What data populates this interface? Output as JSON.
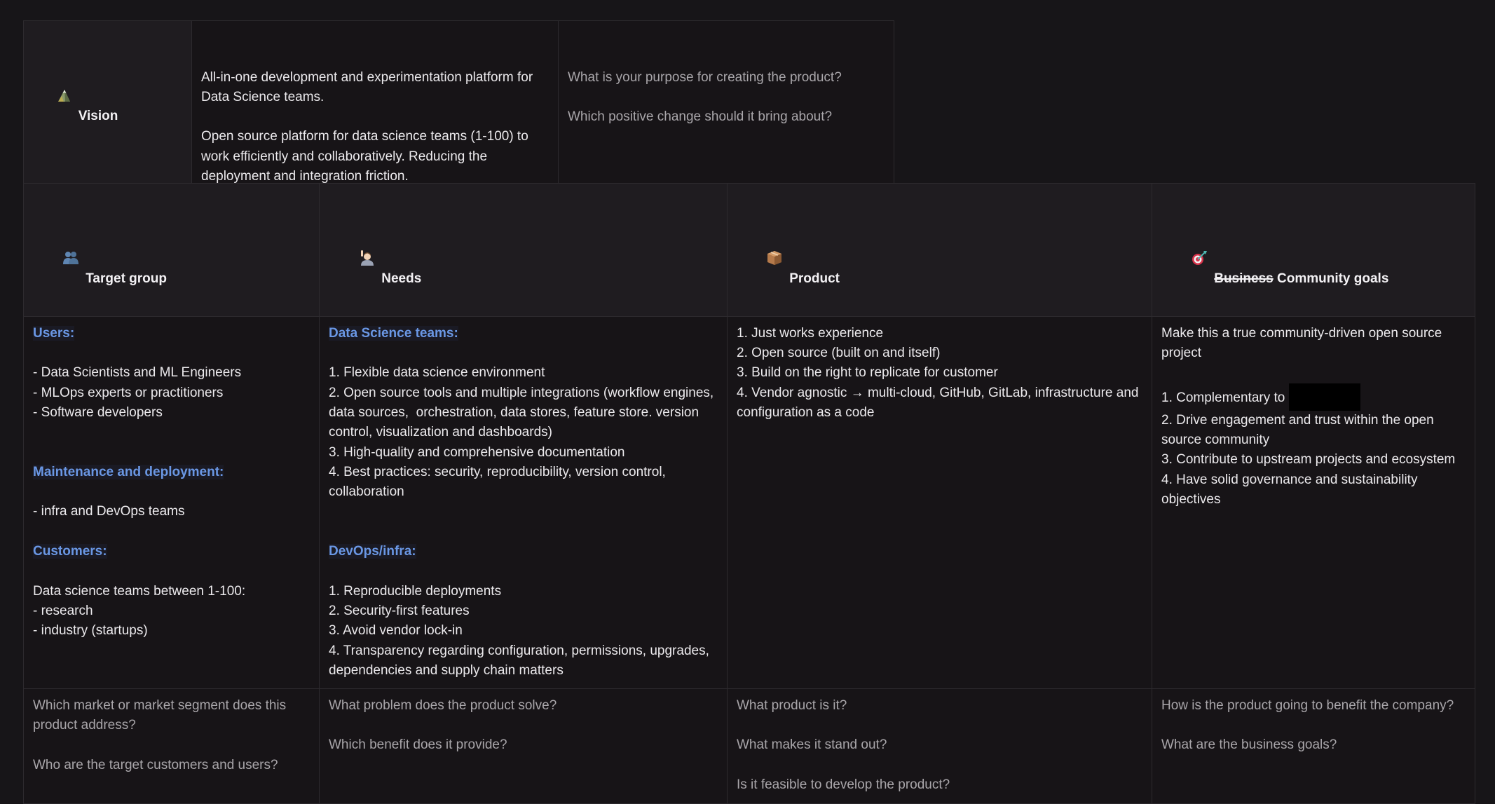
{
  "vision": {
    "icon": "mountain-icon",
    "title": "Vision",
    "statement_lines": [
      "All-in-one development and experimentation platform for Data Science teams.",
      "",
      "Open source platform for data science teams (1-100) to work efficiently and collaboratively. Reducing the deployment and integration friction."
    ],
    "guidance_lines": [
      "What is your purpose for creating the product?",
      "",
      "Which positive change should it bring about?"
    ]
  },
  "board": {
    "columns": [
      {
        "icon": "people-icon",
        "title": "Target group",
        "title_struck": "",
        "content": [
          {
            "type": "label",
            "text": "Users:"
          },
          {
            "type": "blank",
            "text": ""
          },
          {
            "type": "text",
            "text": "- Data Scientists and ML Engineers"
          },
          {
            "type": "text",
            "text": "- MLOps experts or practitioners"
          },
          {
            "type": "text",
            "text": "- Software developers"
          },
          {
            "type": "blank",
            "text": ""
          },
          {
            "type": "blank",
            "text": ""
          },
          {
            "type": "label",
            "text": "Maintenance and deployment:"
          },
          {
            "type": "blank",
            "text": ""
          },
          {
            "type": "text",
            "text": "- infra and DevOps teams"
          },
          {
            "type": "blank",
            "text": ""
          },
          {
            "type": "label",
            "text": "Customers:"
          },
          {
            "type": "blank",
            "text": ""
          },
          {
            "type": "text",
            "text": "Data science teams between 1-100:"
          },
          {
            "type": "text",
            "text": "- research"
          },
          {
            "type": "text",
            "text": "- industry (startups)"
          }
        ],
        "questions": [
          "Which market or market segment does this product address?",
          "",
          "Who are the target customers and users?"
        ]
      },
      {
        "icon": "raising-hand-icon",
        "title": "Needs",
        "title_struck": "",
        "content": [
          {
            "type": "label",
            "text": "Data Science teams:"
          },
          {
            "type": "blank",
            "text": ""
          },
          {
            "type": "text",
            "text": "1. Flexible data science environment"
          },
          {
            "type": "text",
            "text": "2. Open source tools and multiple integrations (workflow engines, data sources,  orchestration, data stores, feature store. version control, visualization and dashboards)"
          },
          {
            "type": "text",
            "text": "3. High-quality and comprehensive documentation"
          },
          {
            "type": "text",
            "text": "4. Best practices: security, reproducibility, version control, collaboration"
          },
          {
            "type": "blank",
            "text": ""
          },
          {
            "type": "blank",
            "text": ""
          },
          {
            "type": "label",
            "text": "DevOps/infra:"
          },
          {
            "type": "blank",
            "text": ""
          },
          {
            "type": "text",
            "text": "1. Reproducible deployments"
          },
          {
            "type": "text",
            "text": "2. Security-first features"
          },
          {
            "type": "text",
            "text": "3. Avoid vendor lock-in"
          },
          {
            "type": "text",
            "text": "4. Transparency regarding configuration, permissions, upgrades, dependencies and supply chain matters"
          }
        ],
        "questions": [
          "What problem does the product solve?",
          "",
          "Which benefit does it provide?"
        ]
      },
      {
        "icon": "package-icon",
        "title": "Product",
        "title_struck": "",
        "content": [
          {
            "type": "text",
            "text": "1. Just works experience"
          },
          {
            "type": "text",
            "text": "2. Open source (built on and itself)"
          },
          {
            "type": "text",
            "text": "3. Build on the right to replicate for customer"
          },
          {
            "type": "text",
            "text": "4. Vendor agnostic → multi-cloud, GitHub, GitLab, infrastructure and configuration as a code"
          }
        ],
        "questions": [
          "What product is it?",
          "",
          "What makes it stand out?",
          "",
          "Is it feasible to develop the product?"
        ]
      },
      {
        "icon": "target-icon",
        "title": "Community goals",
        "title_struck": "Business",
        "content": [
          {
            "type": "text",
            "text": "Make this a true community-driven open source project"
          },
          {
            "type": "blank",
            "text": ""
          },
          {
            "type": "redacted",
            "text": "1. Complementary to "
          },
          {
            "type": "text",
            "text": "2. Drive engagement and trust within the open source community"
          },
          {
            "type": "text",
            "text": "3. Contribute to upstream projects and ecosystem"
          },
          {
            "type": "text",
            "text": "4. Have solid governance and sustainability objectives"
          }
        ],
        "questions": [
          "How is the product going to benefit the company?",
          "",
          "What are the business goals?"
        ]
      }
    ]
  },
  "colors": {
    "background": "#171518",
    "header_background": "#1f1c20",
    "border": "#2d2a2e",
    "text": "#eceaed",
    "muted_text": "#a9a6aa",
    "section_label": "#6a97e4",
    "redaction": "#000000"
  }
}
